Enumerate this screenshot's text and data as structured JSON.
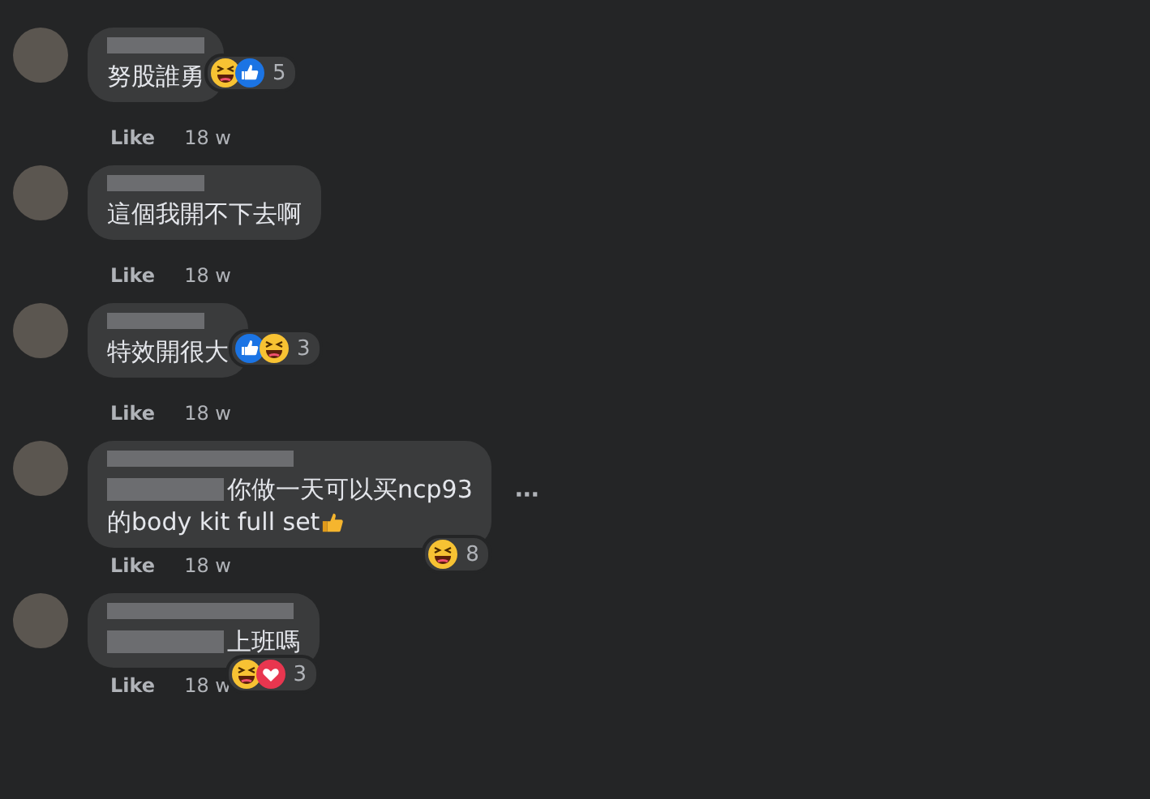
{
  "comments": [
    {
      "kind": "plain",
      "text_lines": [
        "努股誰勇"
      ],
      "reactions": [
        {
          "kind": "haha"
        },
        {
          "kind": "like"
        }
      ],
      "reaction_count": "5",
      "like": "Like",
      "time": "18 w"
    },
    {
      "kind": "plain",
      "text_lines": [
        "這個我開不下去啊"
      ],
      "like": "Like",
      "time": "18 w"
    },
    {
      "kind": "plain",
      "text_lines": [
        "特效開很大"
      ],
      "reactions": [
        {
          "kind": "like"
        },
        {
          "kind": "haha"
        }
      ],
      "reaction_count": "3",
      "like": "Like",
      "time": "18 w"
    },
    {
      "kind": "mention",
      "text_lines": [
        "你做一天可以买ncp93",
        "的body kit full set"
      ],
      "thumb_emoji": true,
      "more": "···",
      "reactions": [
        {
          "kind": "haha"
        }
      ],
      "reaction_count": "8",
      "like": "Like",
      "time": "18 w"
    },
    {
      "kind": "mention",
      "text_lines": [
        "上班嗎"
      ],
      "reactions": [
        {
          "kind": "haha"
        },
        {
          "kind": "love"
        }
      ],
      "reaction_count": "3",
      "like": "Like",
      "time": "18 w"
    }
  ]
}
